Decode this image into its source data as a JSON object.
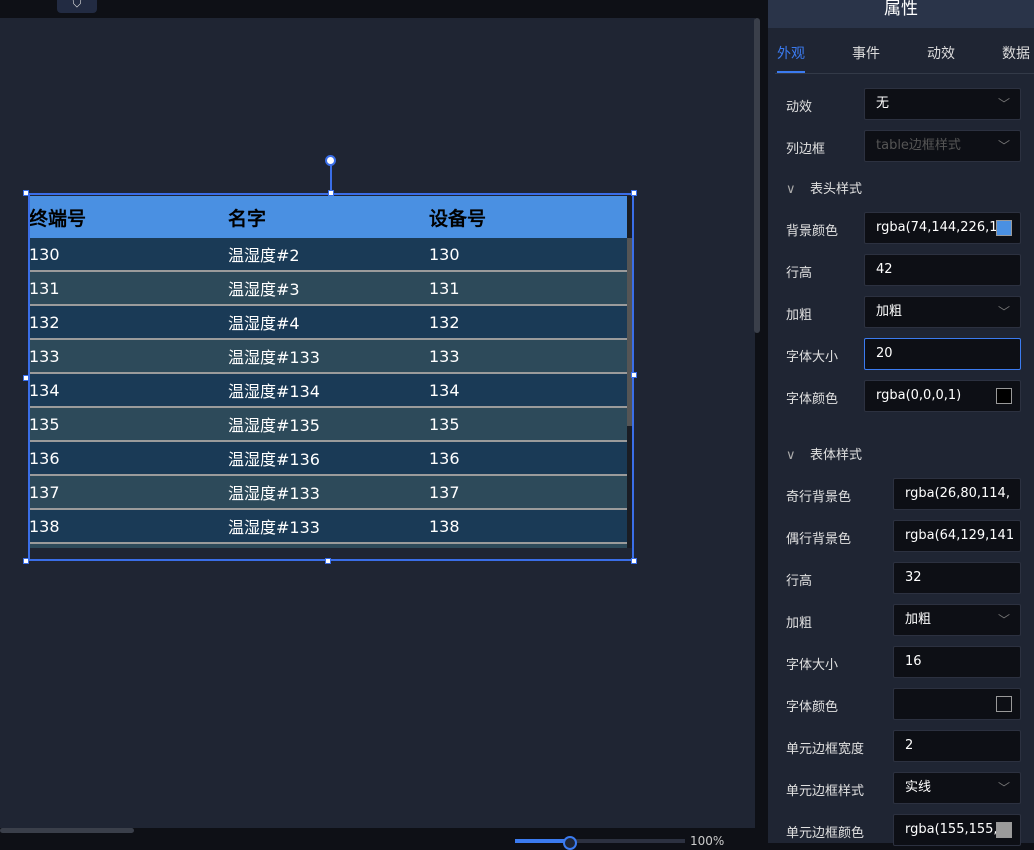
{
  "toolbar": {
    "pin_icon": "pin-icon"
  },
  "zoom": {
    "label": "100%",
    "value": 0.32
  },
  "table": {
    "headers": [
      "终端号",
      "名字",
      "设备号"
    ],
    "rows": [
      [
        "130",
        "温湿度#2",
        "130"
      ],
      [
        "131",
        "温湿度#3",
        "131"
      ],
      [
        "132",
        "温湿度#4",
        "132"
      ],
      [
        "133",
        "温湿度#133",
        "133"
      ],
      [
        "134",
        "温湿度#134",
        "134"
      ],
      [
        "135",
        "温湿度#135",
        "135"
      ],
      [
        "136",
        "温湿度#136",
        "136"
      ],
      [
        "137",
        "温湿度#133",
        "137"
      ],
      [
        "138",
        "温湿度#133",
        "138"
      ]
    ],
    "colors": {
      "header_bg": "#4a90e2",
      "odd_bg": "#1a3a56",
      "even_bg": "#2d4a5a",
      "border": "#9b9b9b"
    }
  },
  "panel": {
    "title": "属性",
    "tabs": [
      "外观",
      "事件",
      "动效",
      "数据"
    ],
    "anim_label": "动效",
    "anim_value": "无",
    "colborder_label": "列边框",
    "colborder_placeholder": "table边框样式",
    "header_section": "表头样式",
    "h_bg_label": "背景颜色",
    "h_bg_value": "rgba(74,144,226,1)",
    "h_rowh_label": "行高",
    "h_rowh_value": "42",
    "h_bold_label": "加粗",
    "h_bold_value": "加粗",
    "h_fs_label": "字体大小",
    "h_fs_value": "20",
    "h_fc_label": "字体颜色",
    "h_fc_value": "rgba(0,0,0,1)",
    "body_section": "表体样式",
    "odd_label": "奇行背景色",
    "odd_value": "rgba(26,80,114,",
    "even_label": "偶行背景色",
    "even_value": "rgba(64,129,141",
    "b_rowh_label": "行高",
    "b_rowh_value": "32",
    "b_bold_label": "加粗",
    "b_bold_value": "加粗",
    "b_fs_label": "字体大小",
    "b_fs_value": "16",
    "b_fc_label": "字体颜色",
    "b_fc_value": "",
    "cbw_label": "单元边框宽度",
    "cbw_value": "2",
    "cbs_label": "单元边框样式",
    "cbs_value": "实线",
    "cbc_label": "单元边框颜色",
    "cbc_value": "rgba(155,155,"
  }
}
